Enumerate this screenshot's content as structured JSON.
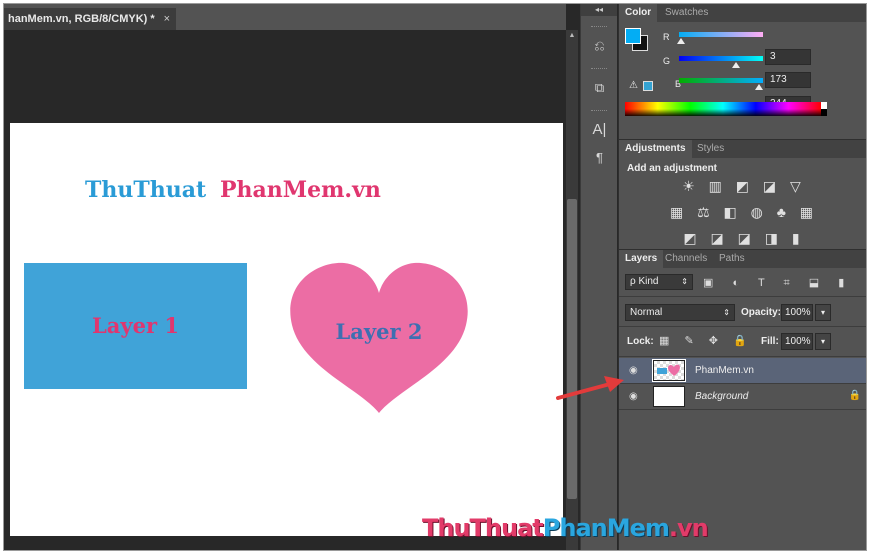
{
  "document": {
    "tab_title": "hanMem.vn, RGB/8/CMYK) *",
    "close_glyph": "×"
  },
  "canvas": {
    "title_part1": "ThuThuat",
    "title_part2": "PhanMem.vn",
    "rect_label": "Layer 1",
    "heart_label": "Layer 2",
    "colors": {
      "title1": "#2a9bd6",
      "title2": "#e0366f",
      "rect": "#40a3d8",
      "heart": "#ec6da4",
      "rect_text": "#e0366f",
      "heart_text": "#3e6fb1"
    }
  },
  "toolcol": {
    "collapse": "◂◂",
    "tools": [
      "history-icon",
      "3d-icon",
      "character-icon",
      "paragraph-icon"
    ],
    "tool_glyphs": [
      "⎌",
      "⧉",
      "A|",
      "¶"
    ]
  },
  "color_panel": {
    "tabs": [
      "Color",
      "Swatches"
    ],
    "channels": [
      {
        "label": "R",
        "value": "3",
        "fraction": 0.01
      },
      {
        "label": "G",
        "value": "173",
        "fraction": 0.68
      },
      {
        "label": "B",
        "value": "244",
        "fraction": 0.96
      }
    ],
    "foreground": "#03adf4",
    "background": "#111111",
    "warning_glyph": "⚠"
  },
  "adjustments_panel": {
    "tabs": [
      "Adjustments",
      "Styles"
    ],
    "heading": "Add an adjustment",
    "rows": [
      [
        "brightness-icon",
        "levels-icon",
        "curves-icon",
        "exposure-icon",
        "vibrance-icon"
      ],
      [
        "hue-sat-icon",
        "color-balance-icon",
        "bw-icon",
        "photo-filter-icon",
        "channel-mixer-icon",
        "color-lookup-icon"
      ],
      [
        "invert-icon",
        "posterize-icon",
        "threshold-icon",
        "selective-color-icon",
        "gradient-map-icon"
      ]
    ],
    "row_glyphs": [
      "☀ ▥ ◩ ◪ ▽",
      "▦ ⚖ ◧ ◍ ♣ ▦",
      "◩ ◪ ◪ ◨ ▮"
    ]
  },
  "layers_panel": {
    "tabs": [
      "Layers",
      "Channels",
      "Paths"
    ],
    "kind_label": "ρ Kind",
    "kind_arrow": "⇕",
    "filter_glyphs": "▣ ◐ T ⌗ ⬓ ▮",
    "blend_mode": "Normal",
    "blend_arrow": "⇕",
    "opacity_label": "Opacity:",
    "opacity_value": "100%",
    "lock_label": "Lock:",
    "lock_glyphs": "▦ ✎ ✥ 🔒",
    "fill_label": "Fill:",
    "fill_value": "100%",
    "dropdown_glyph": "▾",
    "layers": [
      {
        "name": "PhanMem.vn",
        "active": true,
        "locked": false
      },
      {
        "name": "Background",
        "active": false,
        "locked": true
      }
    ],
    "eye_glyph": "◉",
    "lock_glyph": "🔒"
  },
  "watermark": {
    "part1": "ThuThuat",
    "part2": "PhanMem",
    "part3": ".vn"
  }
}
